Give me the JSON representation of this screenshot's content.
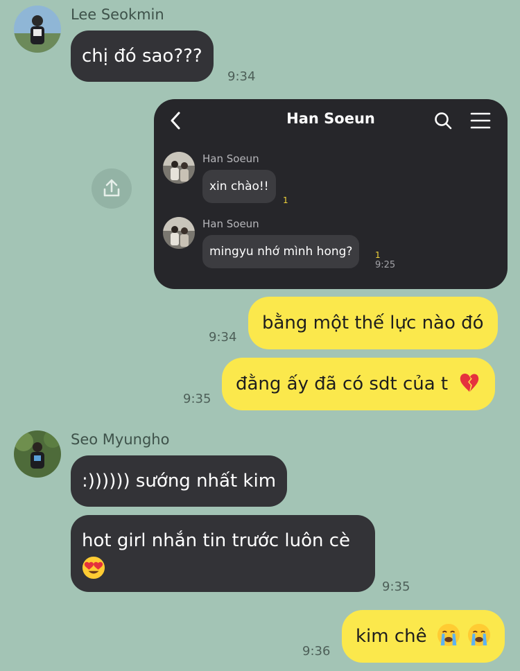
{
  "colors": {
    "background": "#a3c4b5",
    "incoming_bubble": "#333337",
    "outgoing_bubble": "#fbe84c",
    "embedded_bg": "#26262a",
    "unread_count": "#f2d43a"
  },
  "messages": {
    "m1": {
      "sender": "Lee Seokmin",
      "text": "chị đó sao???",
      "time": "9:34"
    },
    "embedded": {
      "header_title": "Han Soeun",
      "icons": [
        "back-icon",
        "search-icon",
        "menu-icon",
        "share-icon"
      ],
      "m1": {
        "sender": "Han Soeun",
        "text": "xin chào!!",
        "unread": "1"
      },
      "m2": {
        "sender": "Han Soeun",
        "text": "mingyu nhớ mình hong?",
        "unread": "1",
        "time": "9:25"
      }
    },
    "m2": {
      "text": "bằng một thế lực nào đó",
      "time": "9:34"
    },
    "m3": {
      "text": "đằng ấy đã có sdt của t",
      "emoji": "broken-heart-emoji",
      "time": "9:35"
    },
    "m4": {
      "sender": "Seo Myungho",
      "text": ":)))))) sướng nhất kim"
    },
    "m5": {
      "text_line1": "hot girl nhắn tin trước luôn cè",
      "emoji": "heart-eyes-emoji",
      "time": "9:35"
    },
    "m6": {
      "text": "kim chê",
      "emoji": "loudly-crying-emoji",
      "time": "9:36"
    }
  }
}
